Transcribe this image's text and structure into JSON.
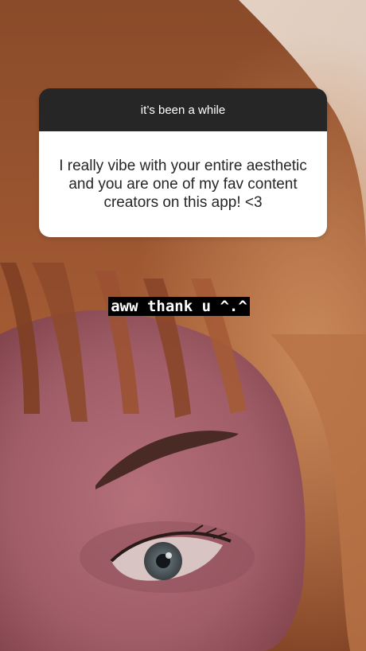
{
  "question": {
    "header": "it’s been a while",
    "body": "I really vibe with your entire aesthetic and you are one of my fav content creators on this app! <3"
  },
  "reply": {
    "text": "aww thank u ^.^"
  },
  "colors": {
    "header_bg": "#262626",
    "card_bg": "#ffffff",
    "reply_bg": "#000000",
    "reply_text": "#ffffff"
  }
}
